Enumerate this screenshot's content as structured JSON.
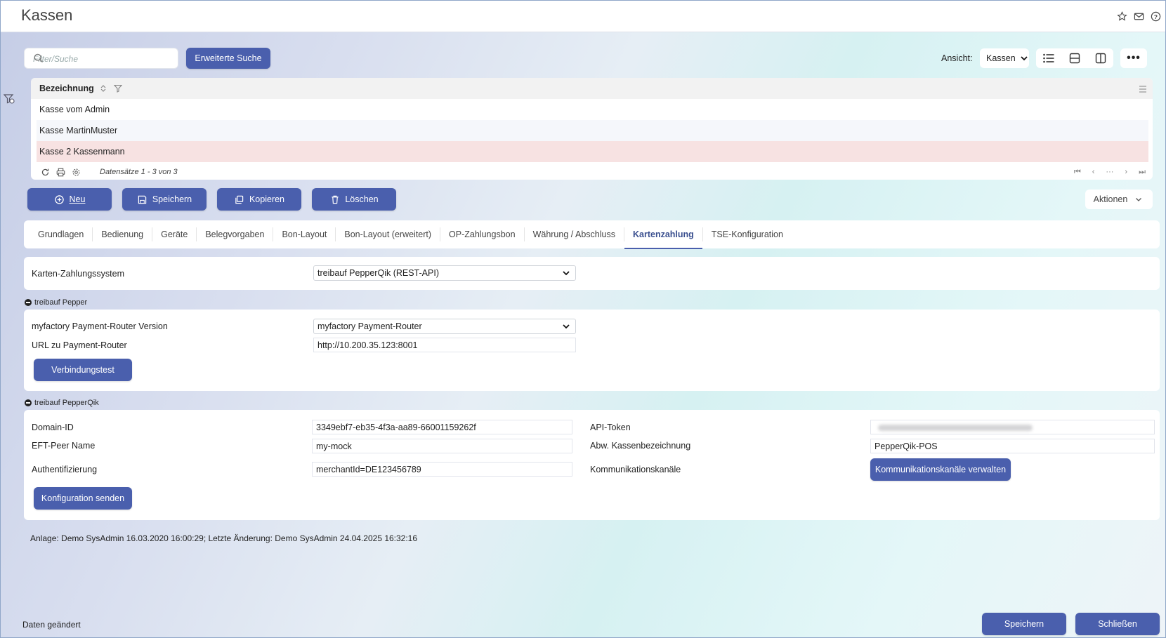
{
  "header": {
    "title": "Kassen"
  },
  "toolbar": {
    "search_placeholder": "Filter/Suche",
    "advanced_search": "Erweiterte Suche",
    "view_label": "Ansicht:",
    "view_value": "Kassen"
  },
  "grid": {
    "column": "Bezeichnung",
    "rows": [
      "Kasse vom Admin",
      "Kasse MartinMuster",
      "Kasse 2 Kassenmann"
    ],
    "footer": "Datensätze 1 - 3 von 3"
  },
  "actions": {
    "new": "Neu",
    "save": "Speichern",
    "copy": "Kopieren",
    "delete": "Löschen",
    "more": "Aktionen"
  },
  "tabs": [
    "Grundlagen",
    "Bedienung",
    "Geräte",
    "Belegvorgaben",
    "Bon-Layout",
    "Bon-Layout (erweitert)",
    "OP-Zahlungsbon",
    "Währung / Abschluss",
    "Kartenzahlung",
    "TSE-Konfiguration"
  ],
  "payment": {
    "system_label": "Karten-Zahlungssystem",
    "system_value": "treibauf PepperQik (REST-API)"
  },
  "pepper": {
    "section": "treibauf Pepper",
    "version_label": "myfactory Payment-Router Version",
    "version_value": "myfactory Payment-Router",
    "url_label": "URL zu Payment-Router",
    "url_value": "http://10.200.35.123:8001",
    "test_button": "Verbindungstest"
  },
  "pepperqik": {
    "section": "treibauf PepperQik",
    "domain_label": "Domain-ID",
    "domain_value": "3349ebf7-eb35-4f3a-aa89-66001159262f",
    "peer_label": "EFT-Peer Name",
    "peer_value": "my-mock",
    "auth_label": "Authentifizierung",
    "auth_value": "merchantId=DE123456789",
    "token_label": "API-Token",
    "alt_label": "Abw. Kassenbezeichnung",
    "alt_value": "PepperQik-POS",
    "channels_label": "Kommunikationskanäle",
    "channels_button": "Kommunikationskanäle verwalten",
    "send_button": "Konfiguration senden"
  },
  "info": "Anlage: Demo SysAdmin 16.03.2020 16:00:29; Letzte Änderung: Demo SysAdmin 24.04.2025 16:32:16",
  "footer": {
    "status": "Daten geändert",
    "save": "Speichern",
    "close": "Schließen"
  },
  "colors": {
    "accent": "#4a5fad",
    "selected_row": "#f7e2e2"
  }
}
